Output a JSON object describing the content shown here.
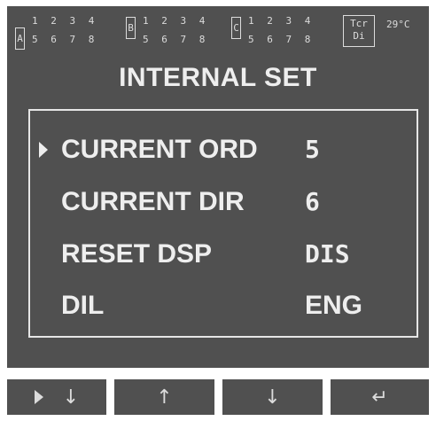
{
  "status": {
    "groups": [
      {
        "id": "A",
        "top": "1 2 3 4",
        "bottom": "5 6 7 8"
      },
      {
        "id": "B",
        "top": "1 2 3 4",
        "bottom": "5 6 7 8"
      },
      {
        "id": "C",
        "top": "1 2 3 4",
        "bottom": "5 6 7 8"
      }
    ],
    "tcr_line1": "Tcr",
    "tcr_line2": "Di",
    "temperature": "29°C"
  },
  "title": "INTERNAL SET",
  "menu": {
    "items": [
      {
        "label": "CURRENT ORD",
        "value": "5",
        "selected": true
      },
      {
        "label": "CURRENT DIR",
        "value": "6",
        "selected": false
      },
      {
        "label": "RESET DSP",
        "value": "DIS",
        "selected": false
      },
      {
        "label": "DIL",
        "value": "ENG",
        "selected": false
      }
    ]
  },
  "softkeys": {
    "key1_icon": "play-down-icon",
    "key1_glyph": "↓",
    "key2_icon": "arrow-up-icon",
    "key2_glyph": "↑",
    "key3_icon": "arrow-down-icon",
    "key3_glyph": "↓",
    "key4_icon": "enter-icon",
    "key4_glyph": "↵"
  },
  "colors": {
    "lcd_background": "#505050",
    "foreground": "#eeeeee",
    "status_text": "#dcdcdc"
  }
}
